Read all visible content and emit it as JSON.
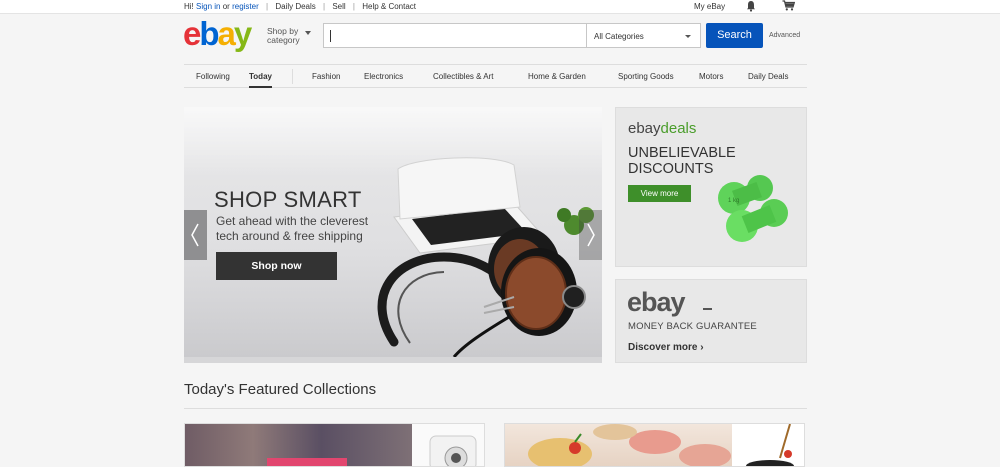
{
  "topbar": {
    "greeting": "Hi!",
    "sign_in": "Sign in",
    "or": "or",
    "register": "register",
    "daily_deals": "Daily Deals",
    "sell": "Sell",
    "help_contact": "Help & Contact",
    "my_ebay": "My eBay",
    "bell_icon": "bell-icon",
    "cart_icon": "cart-icon"
  },
  "header": {
    "logo": {
      "e": "e",
      "b": "b",
      "a": "a",
      "y": "y"
    },
    "shop_by_line1": "Shop by",
    "shop_by_line2": "category",
    "search_placeholder": "",
    "category_selected": "All Categories",
    "search_button": "Search",
    "advanced": "Advanced"
  },
  "nav": {
    "items": [
      "Following",
      "Today",
      "Fashion",
      "Electronics",
      "Collectibles & Art",
      "Home & Garden",
      "Sporting Goods",
      "Motors",
      "Daily Deals"
    ],
    "active": "Today"
  },
  "hero": {
    "title": "SHOP SMART",
    "subtitle_line1": "Get ahead with the cleverest",
    "subtitle_line2": "tech around & free shipping",
    "cta": "Shop now",
    "prev_icon": "chevron-left-icon",
    "next_icon": "chevron-right-icon"
  },
  "deals_ad": {
    "brand_ebay": "ebay",
    "brand_deals": "deals",
    "headline_line1": "UNBELIEVABLE",
    "headline_line2": "DISCOUNTS",
    "button": "View more",
    "dumbbell_label": "1 kg"
  },
  "money_back": {
    "logo": "ebay",
    "guarantee": "MONEY BACK GUARANTEE",
    "discover": "Discover more ›"
  },
  "featured": {
    "title": "Today's Featured Collections"
  },
  "colors": {
    "ebay_red": "#e53238",
    "ebay_blue": "#0064d2",
    "ebay_yellow": "#f5af02",
    "ebay_green": "#86b817",
    "link_blue": "#0654ba",
    "deals_green": "#3e8f2a"
  }
}
